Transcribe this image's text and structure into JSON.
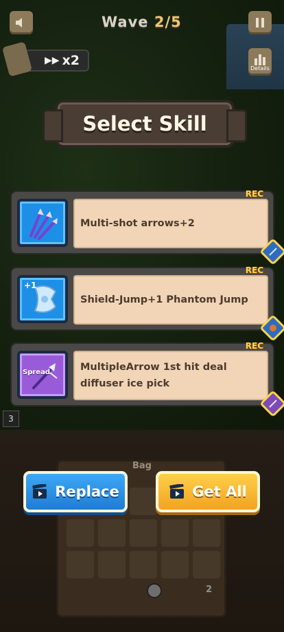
{
  "hud": {
    "wave_label": "Wave",
    "wave_value": "2/5",
    "speed_value": "x2",
    "details_label": "Details"
  },
  "title": "Select Skill",
  "skills": [
    {
      "description": "Multi-shot arrows+2",
      "rec": "REC",
      "icon": "triple-arrow-icon",
      "color": "blue"
    },
    {
      "description": "Shield-Jump+1 Phantom Jump",
      "rec": "REC",
      "icon": "shield-plus-icon",
      "icon_text": "+1",
      "color": "blue"
    },
    {
      "description": "MultipleArrow 1st hit deal diffuser ice pick",
      "rec": "REC",
      "icon": "spread-arrow-icon",
      "icon_text": "Spread",
      "color": "purple"
    }
  ],
  "level_number": "3",
  "bag": {
    "label": "Bag",
    "count": "2"
  },
  "buttons": {
    "replace": "Replace",
    "get_all": "Get All"
  },
  "colors": {
    "accent_blue": "#1e7cd5",
    "accent_gold": "#f2a320",
    "panel": "#f1d5b6",
    "rec": "#ffd44a"
  }
}
